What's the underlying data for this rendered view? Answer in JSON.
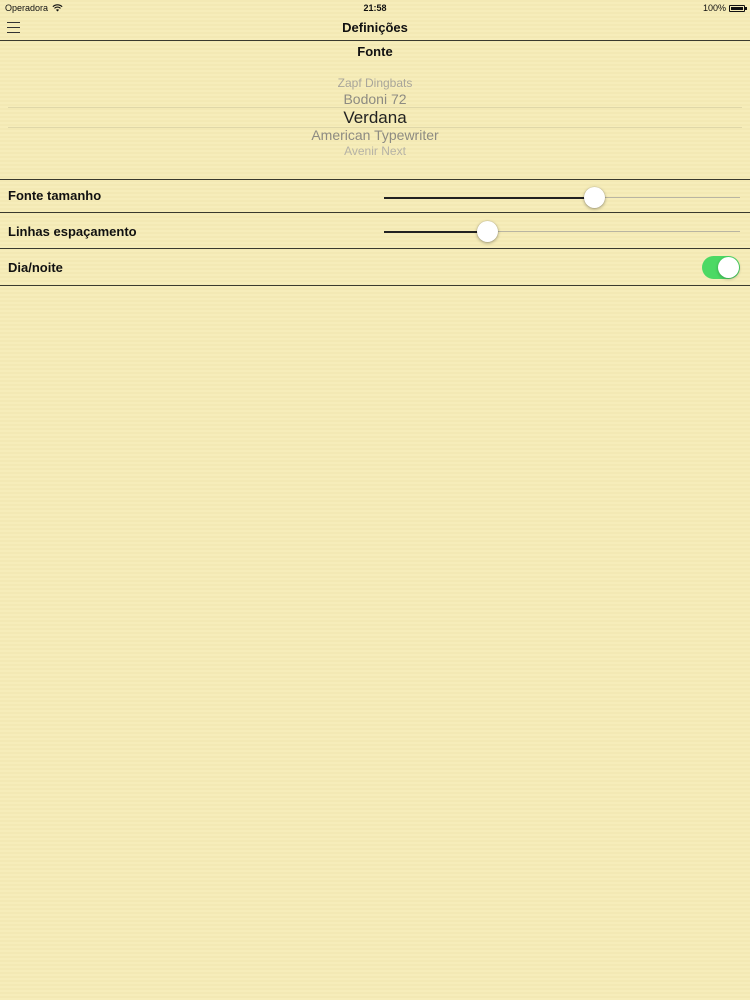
{
  "status_bar": {
    "carrier": "Operadora",
    "time": "21:58",
    "battery": "100%"
  },
  "nav": {
    "title": "Definições",
    "menu_icon": "hamburger-menu-icon"
  },
  "font_section": {
    "title": "Fonte",
    "picker_items": [
      "Zapf Dingbats",
      "Bodoni 72",
      "Verdana",
      "American Typewriter",
      "Avenir Next"
    ],
    "selected": "Verdana"
  },
  "settings": {
    "font_size": {
      "label": "Fonte tamanho",
      "value": 0.59
    },
    "line_spacing": {
      "label": "Linhas espaçamento",
      "value": 0.29
    },
    "day_night": {
      "label": "Dia/noite",
      "on": true
    }
  },
  "colors": {
    "background": "#f6ecb6",
    "toggle_on": "#4cd964"
  }
}
